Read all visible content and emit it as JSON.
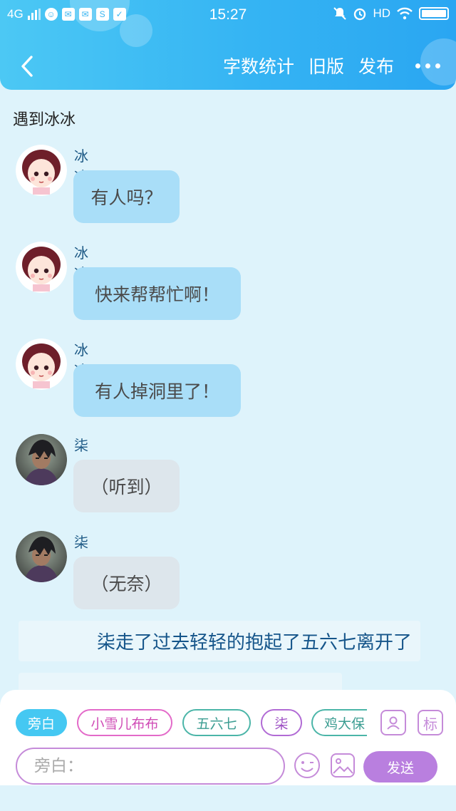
{
  "status_bar": {
    "network": "4G",
    "time": "15:27",
    "hd": "HD",
    "app_badges": [
      "☺",
      "✉",
      "✉",
      "S",
      "✓"
    ]
  },
  "nav": {
    "word_count": "字数统计",
    "old_version": "旧版",
    "publish": "发布"
  },
  "story_title": "遇到冰冰",
  "messages": [
    {
      "name": "冰冰",
      "text": "有人吗？",
      "style": "blue",
      "avatar": "girl"
    },
    {
      "name": "冰冰",
      "text": "快来帮帮忙啊！",
      "style": "blue",
      "avatar": "girl"
    },
    {
      "name": "冰冰",
      "text": "有人掉洞里了！",
      "style": "blue",
      "avatar": "girl"
    },
    {
      "name": "柒",
      "text": "（听到）",
      "style": "grey",
      "avatar": "boy"
    },
    {
      "name": "柒",
      "text": "（无奈）",
      "style": "grey",
      "avatar": "boy"
    }
  ],
  "narration": "柒走了过去轻轻的抱起了五六七离开了",
  "roles": [
    "旁白",
    "小雪儿布布",
    "五六七",
    "柒",
    "鸡大保"
  ],
  "tag_button": "标",
  "input": {
    "placeholder": "旁白："
  },
  "send_label": "发送",
  "colors": {
    "header": "#35b4f3",
    "background": "#def3fb",
    "bubble_blue": "#a9def8",
    "bubble_grey": "#dde6ec",
    "send": "#b97fdf"
  }
}
